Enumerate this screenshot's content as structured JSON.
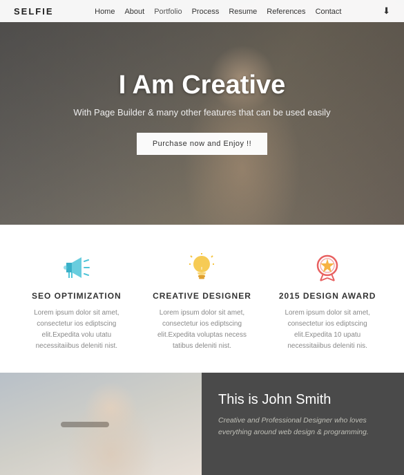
{
  "nav": {
    "logo": "SELFIE",
    "links": [
      {
        "label": "Home",
        "active": false
      },
      {
        "label": "About",
        "active": false
      },
      {
        "label": "Portfolio",
        "active": true
      },
      {
        "label": "Process",
        "active": false
      },
      {
        "label": "Resume",
        "active": false
      },
      {
        "label": "References",
        "active": false
      },
      {
        "label": "Contact",
        "active": false
      }
    ],
    "download_icon": "⬇"
  },
  "hero": {
    "title": "I Am Creative",
    "subtitle": "With Page Builder & many other features that can be used easily",
    "button_label": "Purchase now and Enjoy !!"
  },
  "features": [
    {
      "id": "seo",
      "title": "SEO OPTIMIZATION",
      "text": "Lorem ipsum dolor sit amet, consectetur ios ediptscing elit.Expedita volu utatu necessitaiibus deleniti nist.",
      "icon_type": "megaphone"
    },
    {
      "id": "design",
      "title": "CREATIVE DESIGNER",
      "text": "Lorem ipsum dolor sit amet, consectetur ios ediptscing elit.Expedita voluptas necess tatibus deleniti nist.",
      "icon_type": "bulb"
    },
    {
      "id": "award",
      "title": "2015 DESIGN AWARD",
      "text": "Lorem ipsum dolor sit amet, consectetur ios ediptscing elit.Expedita 10 upatu necessitaiibus deleniti nis.",
      "icon_type": "award"
    }
  ],
  "profile": {
    "name": "This is John Smith",
    "description": "Creative and Professional Designer who loves everything around web design & programming."
  }
}
